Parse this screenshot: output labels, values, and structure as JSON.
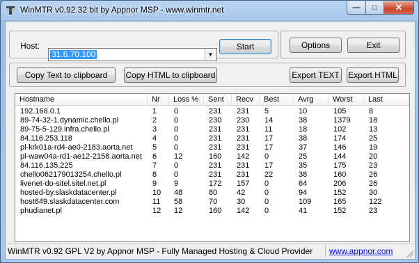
{
  "window": {
    "title": "WinMTR v0.92 32 bit by Appnor MSP - www.winmtr.net"
  },
  "host": {
    "label": "Host:",
    "value": "31.6.70.100"
  },
  "buttons": {
    "start": "Start",
    "options": "Options",
    "exit": "Exit",
    "copy_text": "Copy Text to clipboard",
    "copy_html": "Copy HTML to clipboard",
    "export_text": "Export TEXT",
    "export_html": "Export HTML"
  },
  "table": {
    "columns": [
      "Hostname",
      "Nr",
      "Loss %",
      "Sent",
      "Recv",
      "Best",
      "Avrg",
      "Worst",
      "Last"
    ],
    "rows": [
      [
        "192.168.0.1",
        "1",
        "0",
        "231",
        "231",
        "5",
        "10",
        "105",
        "8"
      ],
      [
        "89-74-32-1.dynamic.chello.pl",
        "2",
        "0",
        "230",
        "230",
        "14",
        "38",
        "1379",
        "18"
      ],
      [
        "89-75-5-129.infra.chello.pl",
        "3",
        "0",
        "231",
        "231",
        "11",
        "18",
        "102",
        "13"
      ],
      [
        "84.116.253.118",
        "4",
        "0",
        "231",
        "231",
        "17",
        "38",
        "174",
        "25"
      ],
      [
        "pl-krk01a-rd4-ae0-2183.aorta.net",
        "5",
        "0",
        "231",
        "231",
        "17",
        "37",
        "146",
        "19"
      ],
      [
        "pl-waw04a-rd1-ae12-2158.aorta.net",
        "6",
        "12",
        "160",
        "142",
        "0",
        "25",
        "144",
        "20"
      ],
      [
        "84.116.135.225",
        "7",
        "0",
        "231",
        "231",
        "17",
        "35",
        "175",
        "23"
      ],
      [
        "chello062179013254.chello.pl",
        "8",
        "0",
        "231",
        "231",
        "22",
        "38",
        "160",
        "26"
      ],
      [
        "livenet-do-sitel.sitel.net.pl",
        "9",
        "9",
        "172",
        "157",
        "0",
        "64",
        "206",
        "26"
      ],
      [
        "hosted-by.slaskdatacenter.pl",
        "10",
        "48",
        "80",
        "42",
        "0",
        "94",
        "152",
        "30"
      ],
      [
        "host649.slaskdatacenter.com",
        "11",
        "58",
        "70",
        "30",
        "0",
        "109",
        "165",
        "122"
      ],
      [
        "phudianet.pl",
        "12",
        "12",
        "160",
        "142",
        "0",
        "41",
        "152",
        "23"
      ]
    ]
  },
  "status": {
    "text": "WinMTR v0.92 GPL V2 by Appnor MSP - Fully Managed Hosting & Cloud Provider",
    "link": "www.appnor.com"
  }
}
